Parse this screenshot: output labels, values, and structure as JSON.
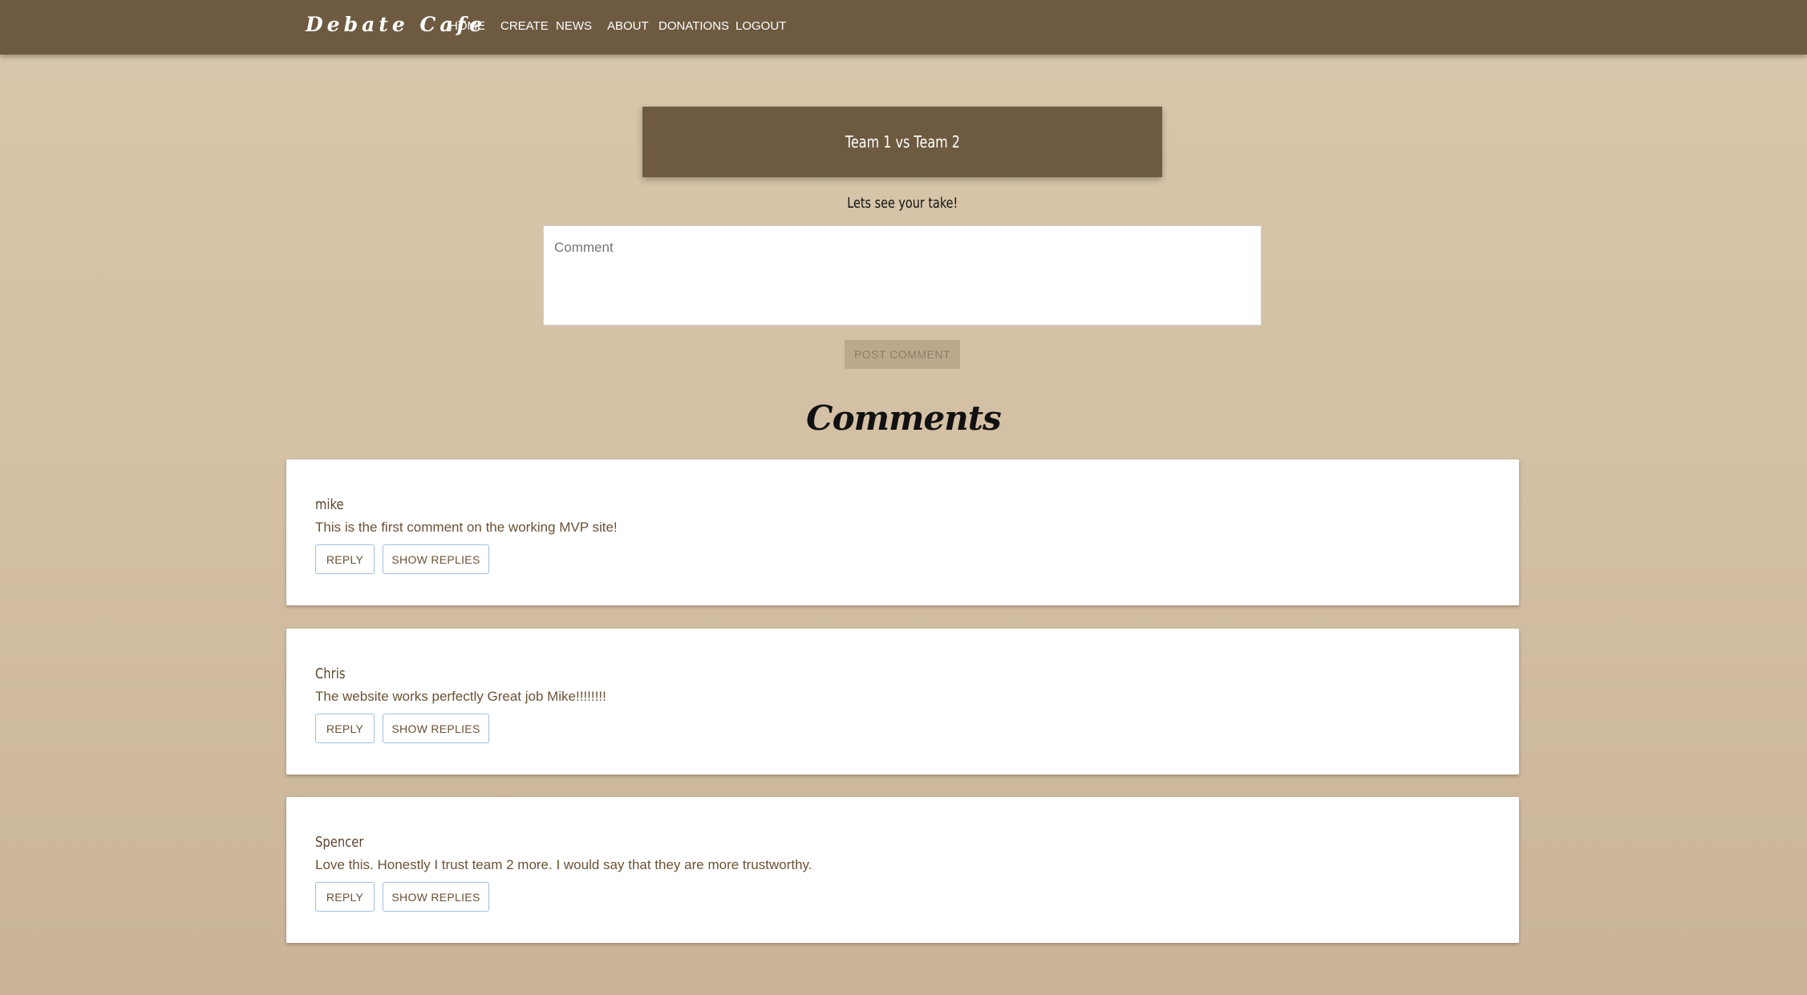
{
  "nav": {
    "brand": "Debate Cafe",
    "links": [
      "HOME",
      "CREATE",
      "NEWS",
      "ABOUT",
      "DONATIONS",
      "LOGOUT"
    ]
  },
  "debate": {
    "title": "Team 1 vs Team 2",
    "prompt": "Lets see your take!"
  },
  "comment_form": {
    "placeholder": "Comment",
    "submit_label": "POST COMMENT"
  },
  "comments_section": {
    "heading": "Comments",
    "reply_label": "REPLY",
    "show_replies_label": "SHOW REPLIES",
    "items": [
      {
        "author": "mike",
        "text": "This is the first comment on the working MVP site!"
      },
      {
        "author": "Chris",
        "text": "The website works perfectly Great job Mike!!!!!!!!"
      },
      {
        "author": "Spencer",
        "text": "Love this. Honestly I trust team 2 more. I would say that they are more trustworthy."
      }
    ]
  },
  "colors": {
    "nav_background": "#6d5a40",
    "page_background": "#d3bfa3",
    "card_background": "#ffffff",
    "button_outline": "#9fbfe0",
    "text_brown": "#6b5234"
  }
}
